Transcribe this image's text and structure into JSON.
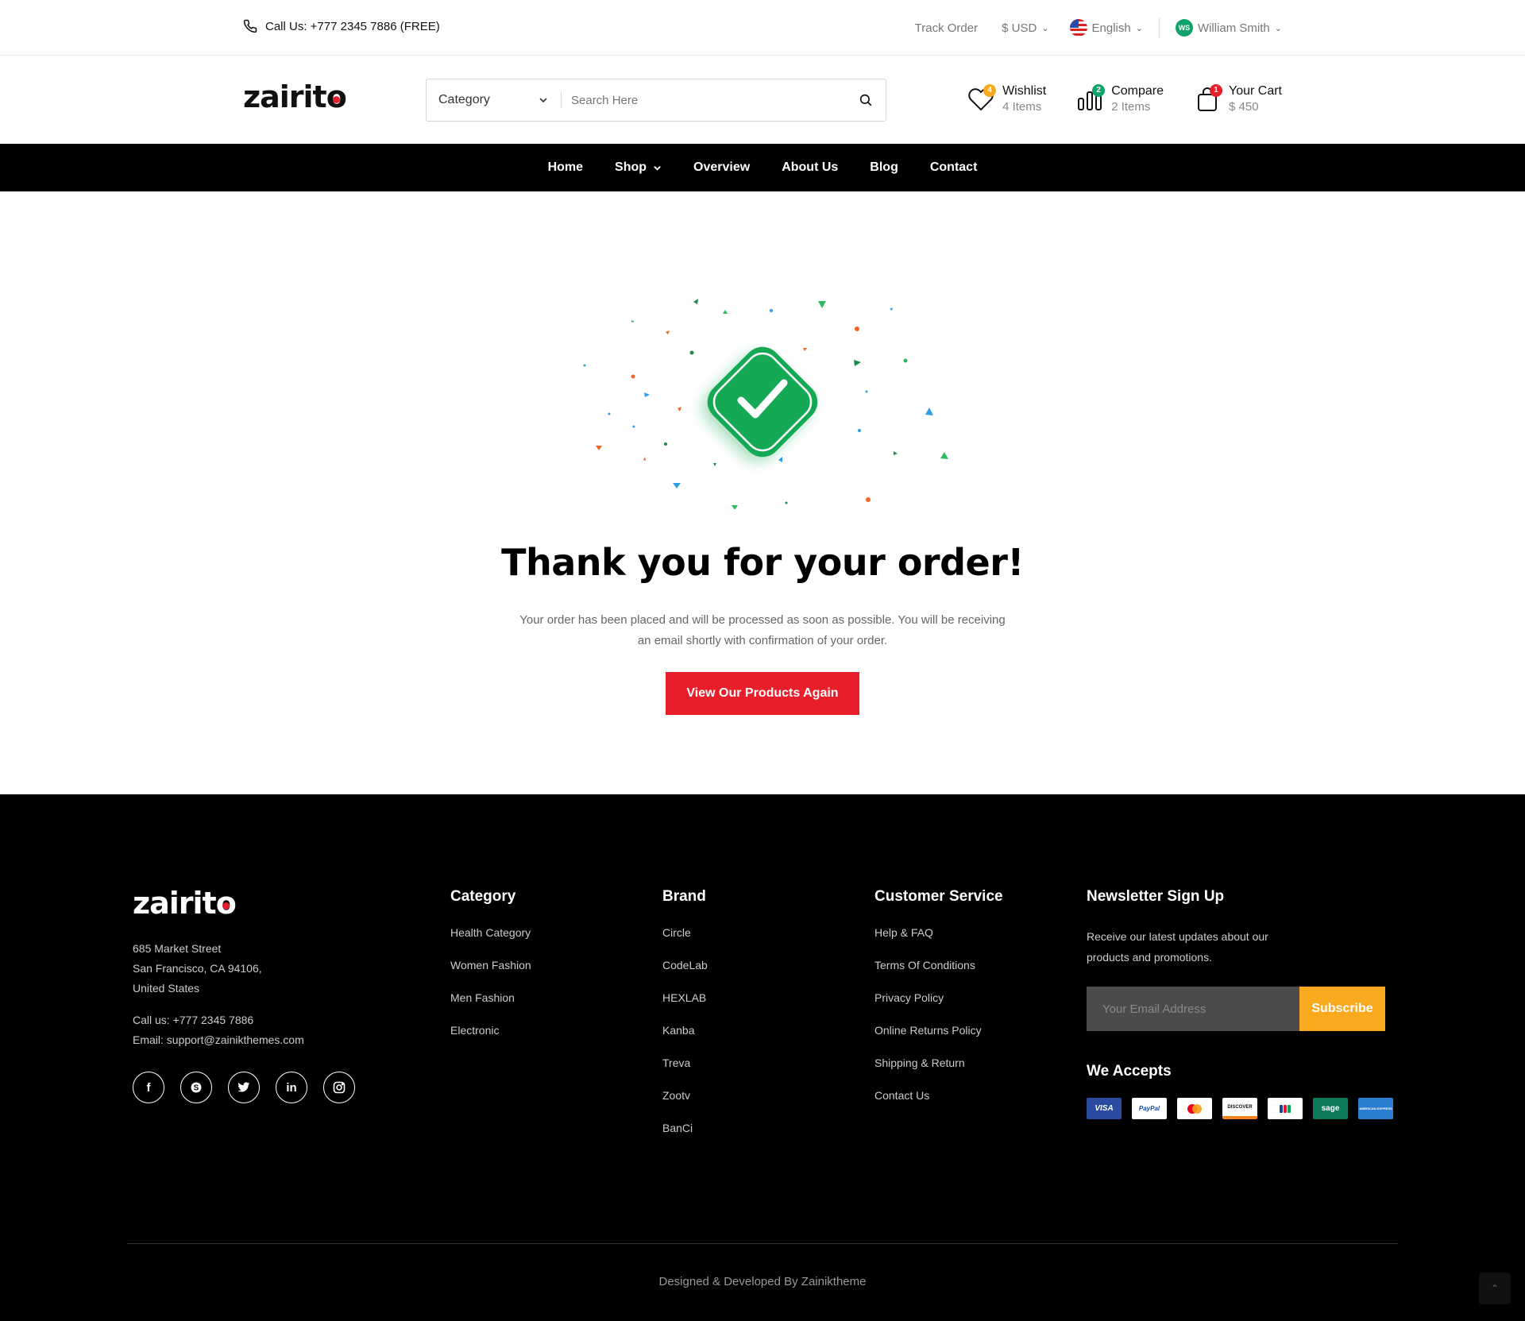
{
  "topbar": {
    "call_text": "Call Us: +777 2345 7886 (FREE)",
    "track_order": "Track Order",
    "currency": "$ USD",
    "language": "English",
    "user_initials": "WS",
    "user_name": "William Smith"
  },
  "header": {
    "logo": "zairito",
    "category_label": "Category",
    "search_placeholder": "Search Here",
    "wishlist": {
      "label": "Wishlist",
      "sub": "4 Items",
      "badge": "4",
      "badge_color": "#f9a91d"
    },
    "compare": {
      "label": "Compare",
      "sub": "2 Items",
      "badge": "2",
      "badge_color": "#11a36b"
    },
    "cart": {
      "label": "Your Cart",
      "sub": "$ 450",
      "badge": "1",
      "badge_color": "#e81e2b"
    }
  },
  "nav": {
    "items": [
      "Home",
      "Shop",
      "Overview",
      "About Us",
      "Blog",
      "Contact"
    ]
  },
  "main": {
    "title": "Thank you for your order!",
    "desc_line1": "Your order has been placed and will be processed as soon as possible. You will be receiving",
    "desc_line2": "an email shortly with confirmation of your order.",
    "cta": "View Our Products Again",
    "accent": "#e81e2b",
    "check_color": "#18a954"
  },
  "footer": {
    "logo": "zairito",
    "address": [
      "685 Market Street",
      "San Francisco, CA 94106,",
      "United States"
    ],
    "call": "Call us: +777 2345 7886",
    "email": "Email: support@zainikthemes.com",
    "socials": [
      "facebook-icon",
      "skype-icon",
      "twitter-icon",
      "linkedin-icon",
      "instagram-icon"
    ],
    "category": {
      "title": "Category",
      "items": [
        "Health Category",
        "Women Fashion",
        "Men Fashion",
        "Electronic"
      ]
    },
    "brand": {
      "title": "Brand",
      "items": [
        "Circle",
        "CodeLab",
        "HEXLAB",
        "Kanba",
        "Treva",
        "Zootv",
        "BanCi"
      ]
    },
    "service": {
      "title": "Customer Service",
      "items": [
        "Help & FAQ",
        "Terms Of Conditions",
        "Privacy Policy",
        "Online Returns Policy",
        "Shipping & Return",
        "Contact Us"
      ]
    },
    "newsletter": {
      "title": "Newsletter Sign Up",
      "text": "Receive our latest updates about our products and promotions.",
      "email_placeholder": "Your Email Address",
      "subscribe": "Subscribe",
      "accepts_title": "We Accepts",
      "cards": [
        "VISA",
        "PayPal",
        "mastercard",
        "DISCOVER",
        "JCB",
        "sage",
        "AMERICAN EXPRESS"
      ]
    },
    "credit": "Designed & Developed By Zainiktheme",
    "subscribe_color": "#f9a91d"
  }
}
